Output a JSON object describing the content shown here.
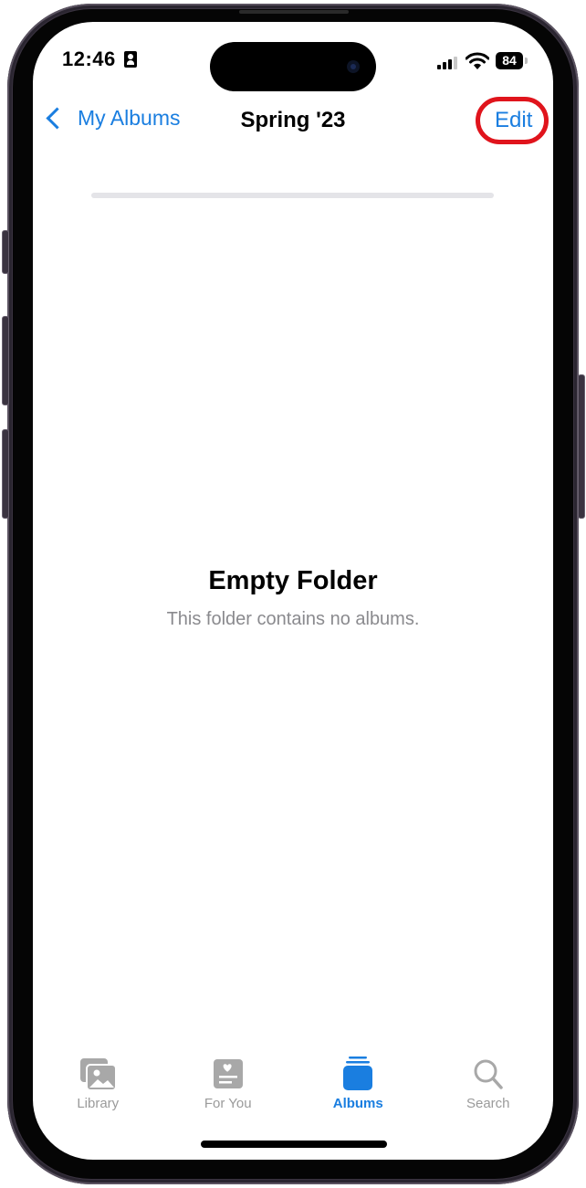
{
  "status_bar": {
    "time": "12:46",
    "battery": "84"
  },
  "navbar": {
    "back_label": "My Albums",
    "title": "Spring '23",
    "edit_label": "Edit"
  },
  "empty_state": {
    "title": "Empty Folder",
    "subtitle": "This folder contains no albums."
  },
  "tabbar": {
    "tabs": [
      {
        "label": "Library",
        "icon": "photo-library-icon",
        "active": false
      },
      {
        "label": "For You",
        "icon": "for-you-icon",
        "active": false
      },
      {
        "label": "Albums",
        "icon": "albums-icon",
        "active": true
      },
      {
        "label": "Search",
        "icon": "search-icon",
        "active": false
      }
    ]
  },
  "colors": {
    "accent": "#1a7ee0",
    "highlight": "#e0141c",
    "inactive_tab": "#9a9a9a",
    "subtitle": "#8a8a8e"
  }
}
